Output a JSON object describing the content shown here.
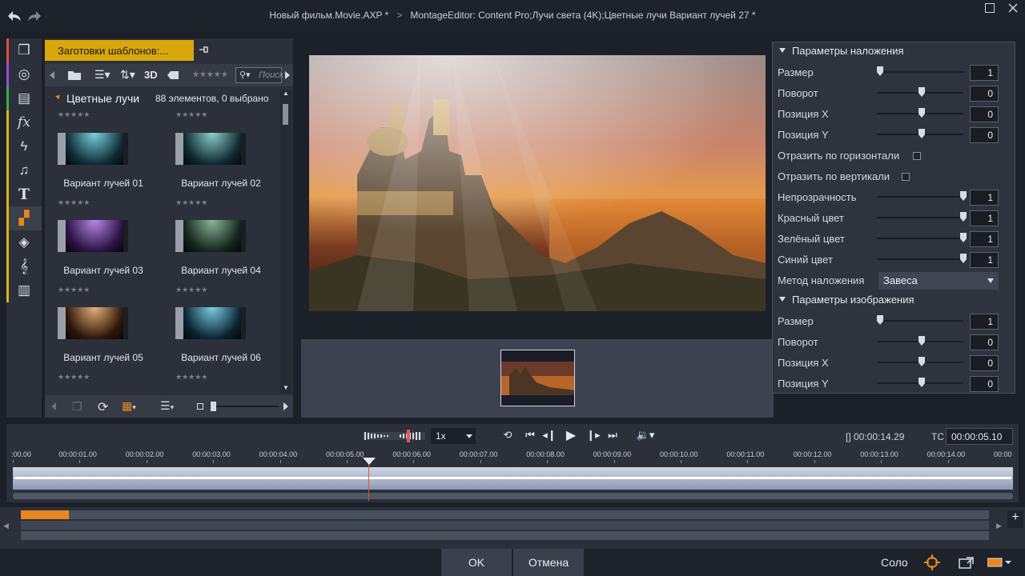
{
  "window": {
    "title_project": "Новый фильм.Movie.AXP *",
    "title_editor": "MontageEditor: Content Pro;Лучи света (4K);Цветные лучи  Вариант лучей 27 *",
    "breadcrumb_sep": ">"
  },
  "library": {
    "tab_label": "Заготовки шаблонов:...",
    "toolbar_3d": "3D",
    "stars": "★★★★★",
    "search_placeholder": "Поиск",
    "category_name": "Цветные лучи",
    "category_count": "88 элементов, 0 выбрано",
    "items": [
      {
        "label": "Вариант лучей 01",
        "c1": "#79d4e0",
        "c2": "#0f2c34"
      },
      {
        "label": "Вариант лучей 02",
        "c1": "#8cd0c9",
        "c2": "#0e2a30"
      },
      {
        "label": "Вариант лучей 03",
        "c1": "#b98ae8",
        "c2": "#2a1242"
      },
      {
        "label": "Вариант лучей 04",
        "c1": "#8fb79a",
        "c2": "#12261b"
      },
      {
        "label": "Вариант лучей 05",
        "c1": "#e8b27a",
        "c2": "#2e1708"
      },
      {
        "label": "Вариант лучей 06",
        "c1": "#7ad0e6",
        "c2": "#0b2430"
      }
    ]
  },
  "overlay_section": {
    "title": "Параметры наложения",
    "rows": [
      {
        "label": "Размер",
        "value": "1",
        "slider": 0.0
      },
      {
        "label": "Поворот",
        "value": "0",
        "slider": 0.5
      },
      {
        "label": "Позиция X",
        "value": "0",
        "slider": 0.5
      },
      {
        "label": "Позиция Y",
        "value": "0",
        "slider": 0.5
      }
    ],
    "flip_h": "Отразить по горизонтали",
    "flip_v": "Отразить по вертикали",
    "color_rows": [
      {
        "label": "Непрозрачность",
        "value": "1",
        "slider": 1.0
      },
      {
        "label": "Красный цвет",
        "value": "1",
        "slider": 1.0
      },
      {
        "label": "Зелёный цвет",
        "value": "1",
        "slider": 1.0
      },
      {
        "label": "Синий цвет",
        "value": "1",
        "slider": 1.0
      }
    ],
    "blend_label": "Метод наложения",
    "blend_value": "Завеса"
  },
  "image_section": {
    "title": "Параметры изображения",
    "rows": [
      {
        "label": "Размер",
        "value": "1",
        "slider": 0.0
      },
      {
        "label": "Поворот",
        "value": "0",
        "slider": 0.5
      },
      {
        "label": "Позиция X",
        "value": "0",
        "slider": 0.5
      },
      {
        "label": "Позиция Y",
        "value": "0",
        "slider": 0.5
      }
    ]
  },
  "transport": {
    "speed": "1x",
    "duration": "[] 00:00:14.29",
    "tc_label": "TC",
    "timecode": "00:00:05.10",
    "playhead_fraction": 0.355
  },
  "timeline": {
    "ticks": [
      ":00.00",
      "00:00:01.00",
      "00:00:02.00",
      "00:00:03.00",
      "00:00:04.00",
      "00:00:05.00",
      "00:00:06.00",
      "00:00:07.00",
      "00:00:08.00",
      "00:00:09.00",
      "00:00:10.00",
      "00:00:11.00",
      "00:00:12.00",
      "00:00:13.00",
      "00:00:14.00",
      "00:00"
    ]
  },
  "bottom": {
    "ok": "OK",
    "cancel": "Отмена",
    "solo": "Соло"
  },
  "colors": {
    "accent_yellow": "#d7a70c",
    "accent_orange": "#e8871e",
    "rail_strips": [
      "#e04c3c",
      "#9b4cd6",
      "#3fa84a",
      "#e1b218",
      "#e1b218",
      "#e1b218",
      "#e1b218",
      "#e1b218",
      "#e1b218",
      "#e1b218",
      "#e1b218"
    ]
  }
}
